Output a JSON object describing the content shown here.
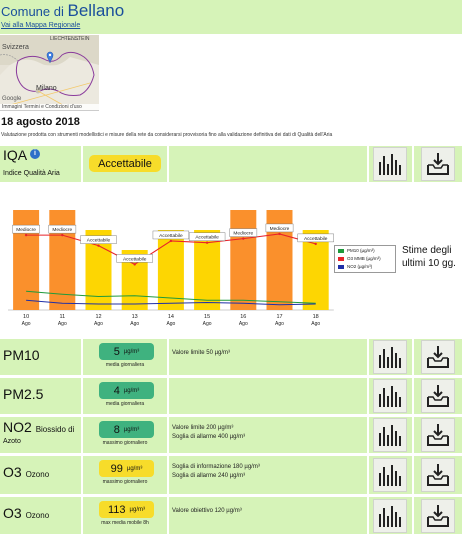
{
  "header": {
    "comune_prefix": "Comune di",
    "city": "Bellano",
    "map_link": "Vai alla Mappa Regionale"
  },
  "map": {
    "label_country": "Svizzera",
    "label_liecht": "LIECHTENSTEIN",
    "label_city": "Milano",
    "label_google": "Google",
    "footer": "Immagini  Termini e Condizioni d'uso"
  },
  "date": "18 agosto 2018",
  "note": "Valutazione prodotta con strumenti modellistici e misure della rete da considerarsi provvisoria fino alla validazione definitiva dei dati di Qualità dell'Aria",
  "iqa": {
    "title": "IQA",
    "subtitle": "Indice Qualità Aria",
    "value": "Accettabile",
    "info_glyph": "i",
    "status_color": "#f7dc2a"
  },
  "chart_data": {
    "type": "bar",
    "categories": [
      "10",
      "11",
      "12",
      "13",
      "14",
      "15",
      "16",
      "17",
      "18"
    ],
    "category_sublabel": "Ago",
    "values": [
      5,
      5,
      4,
      3,
      4,
      4,
      5,
      5,
      4
    ],
    "bar_labels": [
      "Mediocre",
      "Mediocre",
      "Accettabile",
      "Accettabile",
      "Accettabile",
      "Accettabile",
      "Mediocre",
      "Mediocre",
      "Accettabile"
    ],
    "bar_colors": [
      "#fa902c",
      "#fa902c",
      "#fdd602",
      "#fdd602",
      "#fdd602",
      "#fdd602",
      "#fa902c",
      "#fa902c",
      "#fdd602"
    ],
    "ylim": [
      0,
      6
    ],
    "series": [
      {
        "name": "PM10 (µg/m³)",
        "color": "#1f9a3c",
        "values": [
          25,
          21,
          18,
          19,
          16,
          13,
          13,
          11,
          9
        ]
      },
      {
        "name": "O3 MMB (µg/m³)",
        "color": "#e8232a",
        "values": [
          128,
          128,
          110,
          78,
          118,
          115,
          122,
          130,
          113
        ]
      },
      {
        "name": "NO2 (µg/m³)",
        "color": "#1f2fa8",
        "values": [
          13,
          9,
          8,
          8,
          9,
          10,
          9,
          7,
          8
        ]
      }
    ],
    "line_ylim": [
      0,
      160
    ],
    "side_note": [
      "Stime degli",
      "ultimi 10 gg."
    ]
  },
  "pollutants": [
    {
      "name": "PM10",
      "sub": "",
      "value": "5",
      "unit": "µg/m³",
      "stat": "media giornaliera",
      "color": "#3fb27f",
      "desc": [
        "Valore limite 50 µg/m³"
      ]
    },
    {
      "name": "PM2.5",
      "sub": "",
      "value": "4",
      "unit": "µg/m³",
      "stat": "media giornaliera",
      "color": "#3fb27f",
      "desc": []
    },
    {
      "name": "NO2",
      "sub": "Biossido di Azoto",
      "value": "8",
      "unit": "µg/m³",
      "stat": "massimo giornaliero",
      "color": "#3fb27f",
      "desc": [
        "Valore limite 200 µg/m³",
        "Soglia di allarme 400 µg/m³"
      ]
    },
    {
      "name": "O3",
      "sub": "Ozono",
      "value": "99",
      "unit": "µg/m³",
      "stat": "massimo giornaliero",
      "color": "#f7dc2a",
      "desc": [
        "Soglia di informazione 180 µg/m³",
        "Soglia di allarme 240 µg/m³"
      ]
    },
    {
      "name": "O3",
      "sub": "Ozono",
      "value": "113",
      "unit": "µg/m³",
      "stat": "max media mobile 8h",
      "color": "#f7dc2a",
      "desc": [
        "Valore obiettivo 120 µg/m³"
      ]
    }
  ],
  "icons": {
    "chart": "bar-chart-icon",
    "download": "download-icon"
  }
}
